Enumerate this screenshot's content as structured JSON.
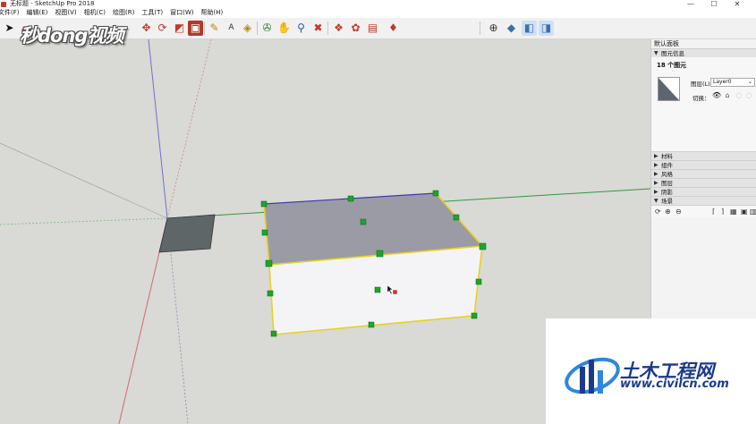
{
  "window": {
    "title": "无标题 - SketchUp Pro 2018",
    "controls": [
      "—",
      "☐",
      "✕"
    ]
  },
  "menu": {
    "items": [
      "文件(F)",
      "编辑(E)",
      "视图(V)",
      "相机(C)",
      "绘图(R)",
      "工具(T)",
      "窗口(W)",
      "帮助(H)"
    ]
  },
  "toolbar": {
    "icons": [
      "select-arrow-icon",
      "eraser-icon",
      "pencil-icon",
      "rectangle-icon",
      "circle-icon",
      "arc-icon",
      "move-icon",
      "rotate-icon",
      "scale-icon",
      "push-pull-icon",
      "offset-icon",
      "tape-measure-icon",
      "text-icon",
      "paint-bucket-icon",
      "orbit-icon",
      "pan-icon",
      "zoom-icon",
      "zoom-extents-icon",
      "warehouse-icon",
      "extension-icon",
      "send-icon",
      "ruby-icon",
      "axes-icon",
      "iso-view-icon",
      "front-view-icon",
      "top-view-icon"
    ]
  },
  "watermark": {
    "logo_text": "秒dong视频",
    "site_name": "土木工程网",
    "site_url": "www.civilcn.com"
  },
  "tray": {
    "title": "默认面板",
    "entity_info": {
      "header": "图元信息",
      "count_label": "18 个图元",
      "layer_label": "图层(L):",
      "layer_value": "Layer0",
      "toggle_label": "切换："
    },
    "sections": [
      "材料",
      "组件",
      "风格",
      "图层",
      "阴影",
      "场景"
    ]
  },
  "colors": {
    "viewport_bg": "#d9d9d5",
    "top_face": "#9b9ba6",
    "front_face": "#f4f4f6",
    "selection_edge": "#e8d21e",
    "blue_edge": "#3b3bb0",
    "grip": "#17a82a",
    "green_axis": "#2f9a3b",
    "blue_axis": "#7070d0",
    "red_axis": "#d06b6b",
    "brand_blue": "#1b3a8c"
  }
}
